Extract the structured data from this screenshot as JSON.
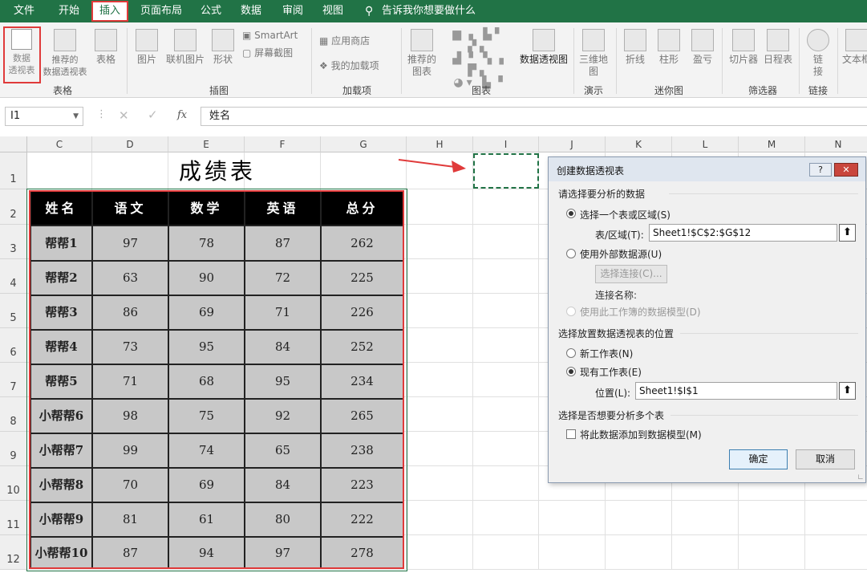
{
  "menu": {
    "items": [
      "文件",
      "开始",
      "插入",
      "页面布局",
      "公式",
      "数据",
      "审阅",
      "视图"
    ],
    "tellme": "告诉我你想要做什么"
  },
  "ribbon": {
    "pivot_table": "数据\n透视表",
    "recommended_pivot": "推荐的\n数据透视表",
    "table": "表格",
    "pictures": "图片",
    "online_pictures": "联机图片",
    "shapes": "形状",
    "smartart": "SmartArt",
    "screenshot": "屏幕截图",
    "store": "应用商店",
    "my_addins": "我的加载项",
    "recommended_charts": "推荐的\n图表",
    "pivot_chart": "数据透视图",
    "map3d": "三维地\n图",
    "line": "折线",
    "column": "柱形",
    "winloss": "盈亏",
    "slicer": "切片器",
    "timeline": "日程表",
    "link": "链\n接",
    "textbox": "文本框",
    "groups": {
      "tables": "表格",
      "illustrations": "插图",
      "addins": "加载项",
      "charts": "图表",
      "tours": "演示",
      "sparklines": "迷你图",
      "filters": "筛选器",
      "links": "链接"
    }
  },
  "formula_bar": {
    "name_box": "I1",
    "fx": "fx",
    "value": "姓名"
  },
  "columns": [
    "C",
    "D",
    "E",
    "F",
    "G",
    "H",
    "I",
    "J",
    "K",
    "L",
    "M",
    "N"
  ],
  "rows": [
    "1",
    "2",
    "3",
    "4",
    "5",
    "6",
    "7",
    "8",
    "9",
    "10",
    "11",
    "12"
  ],
  "sheet_title": "成绩表",
  "table": {
    "headers": [
      "姓名",
      "语文",
      "数学",
      "英语",
      "总分"
    ],
    "rows": [
      [
        "帮帮1",
        "97",
        "78",
        "87",
        "262"
      ],
      [
        "帮帮2",
        "63",
        "90",
        "72",
        "225"
      ],
      [
        "帮帮3",
        "86",
        "69",
        "71",
        "226"
      ],
      [
        "帮帮4",
        "73",
        "95",
        "84",
        "252"
      ],
      [
        "帮帮5",
        "71",
        "68",
        "95",
        "234"
      ],
      [
        "小帮帮6",
        "98",
        "75",
        "92",
        "265"
      ],
      [
        "小帮帮7",
        "99",
        "74",
        "65",
        "238"
      ],
      [
        "小帮帮8",
        "70",
        "69",
        "84",
        "223"
      ],
      [
        "小帮帮9",
        "81",
        "61",
        "80",
        "222"
      ],
      [
        "小帮帮10",
        "87",
        "94",
        "97",
        "278"
      ]
    ]
  },
  "dialog": {
    "title": "创建数据透视表",
    "help": "?",
    "section1": "请选择要分析的数据",
    "opt_range": "选择一个表或区域(S)",
    "range_label": "表/区域(T):",
    "range_value": "Sheet1!$C$2:$G$12",
    "opt_external": "使用外部数据源(U)",
    "choose_conn": "选择连接(C)...",
    "conn_name": "连接名称:",
    "opt_datamodel": "使用此工作簿的数据模型(D)",
    "section2": "选择放置数据透视表的位置",
    "opt_new": "新工作表(N)",
    "opt_existing": "现有工作表(E)",
    "location_label": "位置(L):",
    "location_value": "Sheet1!$I$1",
    "section3": "选择是否想要分析多个表",
    "add_model": "将此数据添加到数据模型(M)",
    "ok": "确定",
    "cancel": "取消"
  },
  "colors": {
    "excel_green": "#217346",
    "highlight_red": "#e03a3a",
    "header_black": "#000000",
    "cell_gray": "#c8c8c8"
  }
}
